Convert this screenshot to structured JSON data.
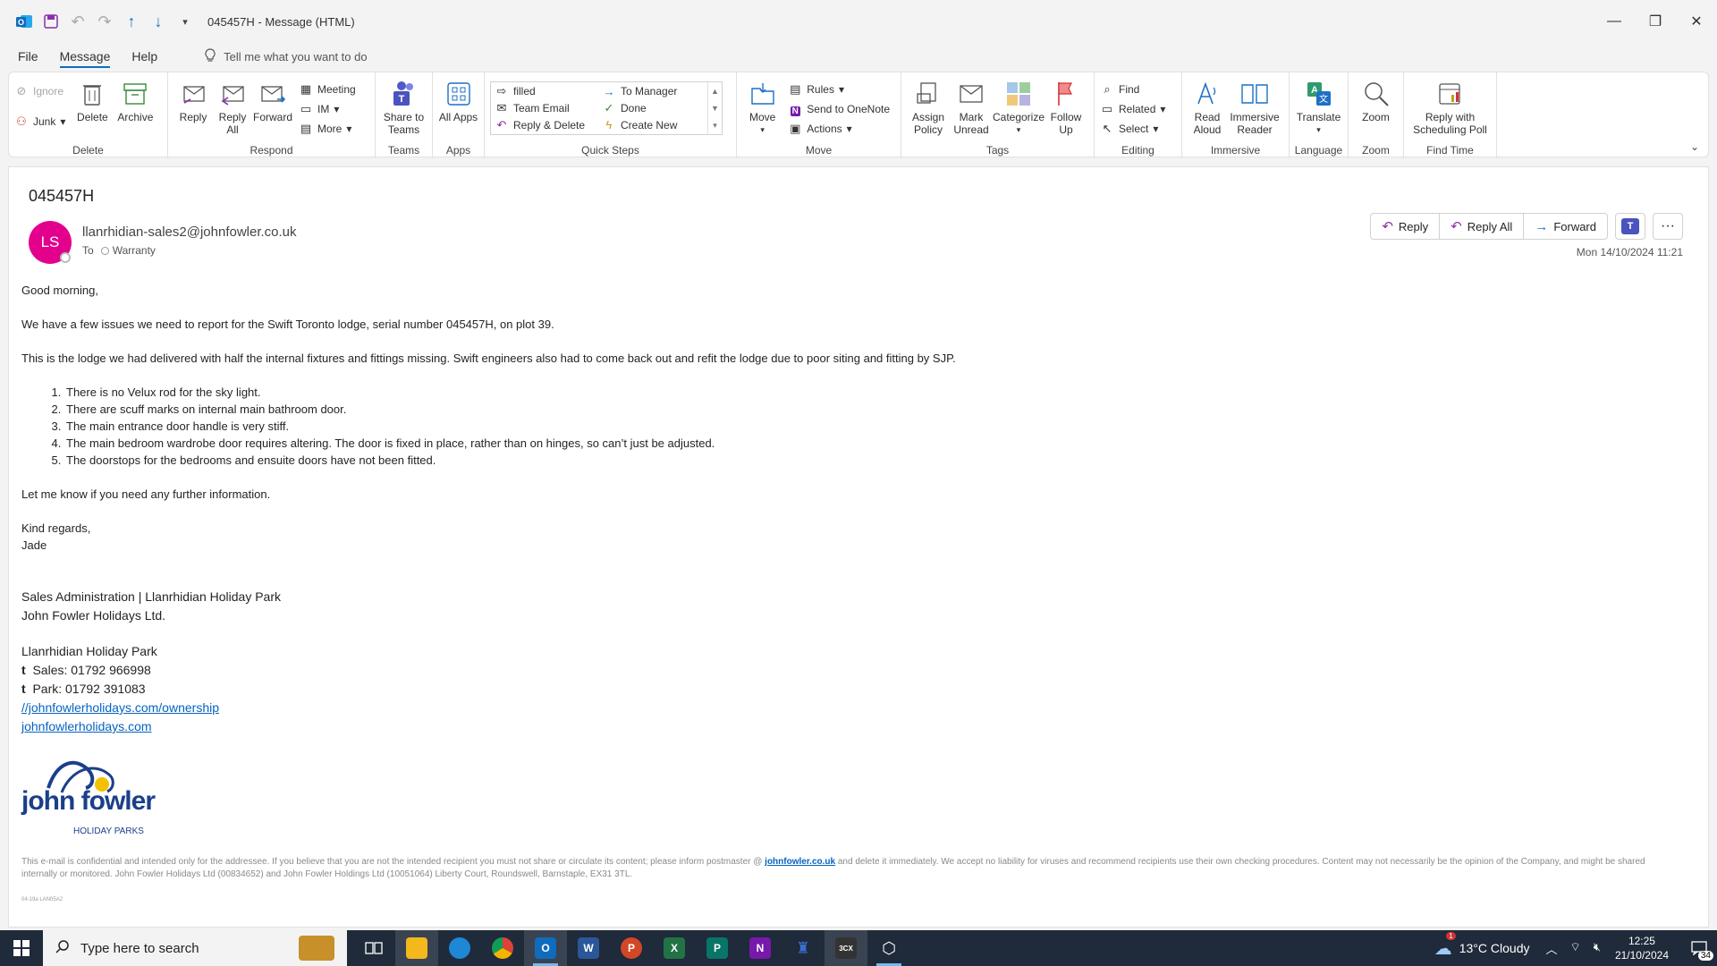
{
  "window": {
    "title": "045457H  -  Message (HTML)"
  },
  "menu": {
    "file": "File",
    "message": "Message",
    "help": "Help",
    "tellme": "Tell me what you want to do"
  },
  "ribbon": {
    "delete_group": {
      "label": "Delete",
      "ignore": "Ignore",
      "junk": "Junk",
      "delete": "Delete",
      "archive": "Archive"
    },
    "respond_group": {
      "label": "Respond",
      "reply": "Reply",
      "reply_all": "Reply All",
      "forward": "Forward",
      "meeting": "Meeting",
      "im": "IM",
      "more": "More"
    },
    "teams_group": {
      "label": "Teams",
      "share": "Share to Teams"
    },
    "apps_group": {
      "label": "Apps",
      "all_apps": "All Apps"
    },
    "quicksteps_group": {
      "label": "Quick Steps",
      "items": [
        "filled",
        "Team Email",
        "Reply & Delete",
        "To Manager",
        "Done",
        "Create New"
      ]
    },
    "move_group": {
      "label": "Move",
      "move": "Move",
      "rules": "Rules",
      "onenote": "Send to OneNote",
      "actions": "Actions"
    },
    "tags_group": {
      "label": "Tags",
      "assign_policy": "Assign Policy",
      "mark_unread": "Mark Unread",
      "categorize": "Categorize",
      "follow_up": "Follow Up"
    },
    "editing_group": {
      "label": "Editing",
      "find": "Find",
      "related": "Related",
      "select": "Select"
    },
    "immersive_group": {
      "label": "Immersive",
      "read_aloud": "Read Aloud",
      "immersive_reader": "Immersive Reader"
    },
    "language_group": {
      "label": "Language",
      "translate": "Translate"
    },
    "zoom_group": {
      "label": "Zoom",
      "zoom": "Zoom"
    },
    "findtime_group": {
      "label": "Find Time",
      "poll": "Reply with Scheduling Poll"
    }
  },
  "message": {
    "subject": "045457H",
    "avatar_initials": "LS",
    "avatar_color": "#e3008c",
    "sender": "llanrhidian-sales2@johnfowler.co.uk",
    "to_label": "To",
    "recipient": "Warranty",
    "date": "Mon 14/10/2024 11:21",
    "actions": {
      "reply": "Reply",
      "reply_all": "Reply All",
      "forward": "Forward"
    },
    "greeting": "Good morning,",
    "para1": "We have a few issues we need to report for the Swift Toronto lodge, serial number 045457H, on plot 39.",
    "para2": "This is the lodge we had delivered with half the internal fixtures and fittings missing. Swift engineers also had to come back out and refit the lodge due to poor siting and fitting by SJP.",
    "issues": [
      "There is no Velux rod for the sky light.",
      "There are scuff marks on internal main bathroom door.",
      "The main entrance door handle is very stiff.",
      "The main bedroom wardrobe door requires altering. The door is fixed in place, rather than on hinges, so can’t just be adjusted.",
      "The doorstops for the bedrooms and ensuite doors have not been fitted."
    ],
    "para3": "Let me know if you need any further information.",
    "closing": "Kind regards,",
    "name": "Jade",
    "sig_title": "Sales Administration | Llanrhidian Holiday Park",
    "sig_company": "John Fowler Holidays Ltd.",
    "sig_park": "Llanrhidian Holiday Park",
    "sig_t1": "t",
    "sig_sales": "Sales: 01792 966998",
    "sig_t2": "t",
    "sig_parkphone": "Park:  01792 391083",
    "link1": "//johnfowlerholidays.com/ownership",
    "link2": "johnfowlerholidays.com",
    "logo_text1": "john fowler",
    "logo_text2": "HOLIDAY PARKS",
    "disclaimer_a": "This e-mail is confidential and intended only for the addressee. If you believe that you are not the intended recipient  you must not share or circulate its content; please inform postmaster @ ",
    "disclaimer_link": "johnfowler.co.uk",
    "disclaimer_b": " and delete it immediately. We accept no liability for viruses and recommend recipients use their own checking procedures. Content may not necessarily be the opinion of the Company, and might be shared internally or monitored. John Fowler Holidays Ltd (00834652) and John Fowler Holdings Ltd (10051064) Liberty Court, Roundswell, Barnstaple, EX31 3TL.",
    "tiny": "04-19a LAN05A2"
  },
  "taskbar": {
    "search_placeholder": "Type here to search",
    "weather": "13°C  Cloudy",
    "weather_badge": "1",
    "time": "12:25",
    "date": "21/10/2024",
    "notifications": "34"
  }
}
